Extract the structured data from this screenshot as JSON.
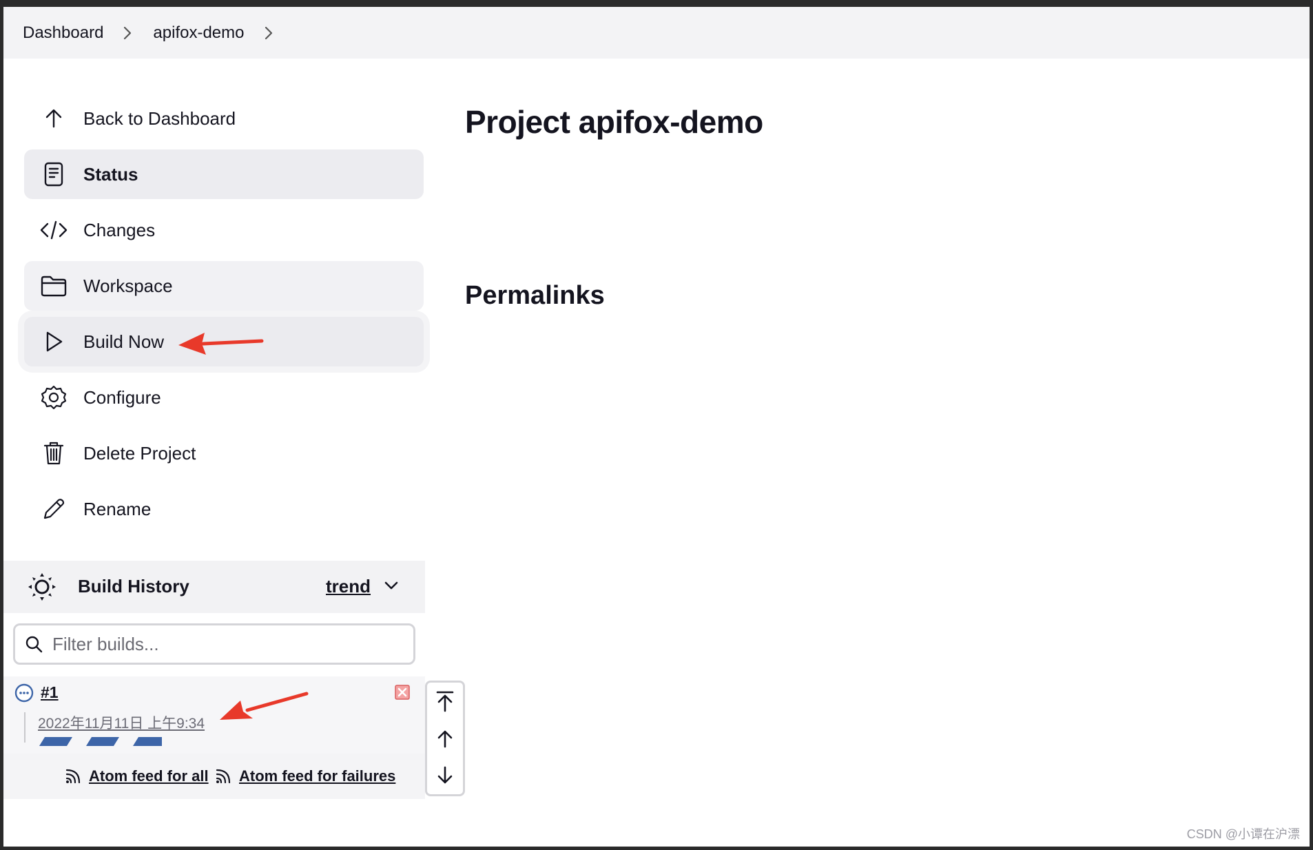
{
  "breadcrumb": {
    "items": [
      "Dashboard",
      "apifox-demo"
    ]
  },
  "sidebar": {
    "items": [
      {
        "label": "Back to Dashboard",
        "icon": "arrow-up-icon"
      },
      {
        "label": "Status",
        "icon": "document-icon"
      },
      {
        "label": "Changes",
        "icon": "code-icon"
      },
      {
        "label": "Workspace",
        "icon": "folder-icon"
      },
      {
        "label": "Build Now",
        "icon": "play-icon"
      },
      {
        "label": "Configure",
        "icon": "gear-icon"
      },
      {
        "label": "Delete Project",
        "icon": "trash-icon"
      },
      {
        "label": "Rename",
        "icon": "pencil-icon"
      }
    ],
    "active_item": "Status"
  },
  "main": {
    "title": "Project apifox-demo",
    "permalinks_title": "Permalinks"
  },
  "build_history": {
    "title": "Build History",
    "trend_label": "trend",
    "filter_placeholder": "Filter builds...",
    "builds": [
      {
        "number": "#1",
        "date": "2022年11月11日 上午9:34",
        "status": "in-progress"
      }
    ],
    "feeds": {
      "all": "Atom feed for all",
      "failures": "Atom feed for failures"
    }
  },
  "annotation_color": "#e8392a",
  "progress_color": "#3d65a8",
  "watermark": "CSDN @小谭在沪漂"
}
